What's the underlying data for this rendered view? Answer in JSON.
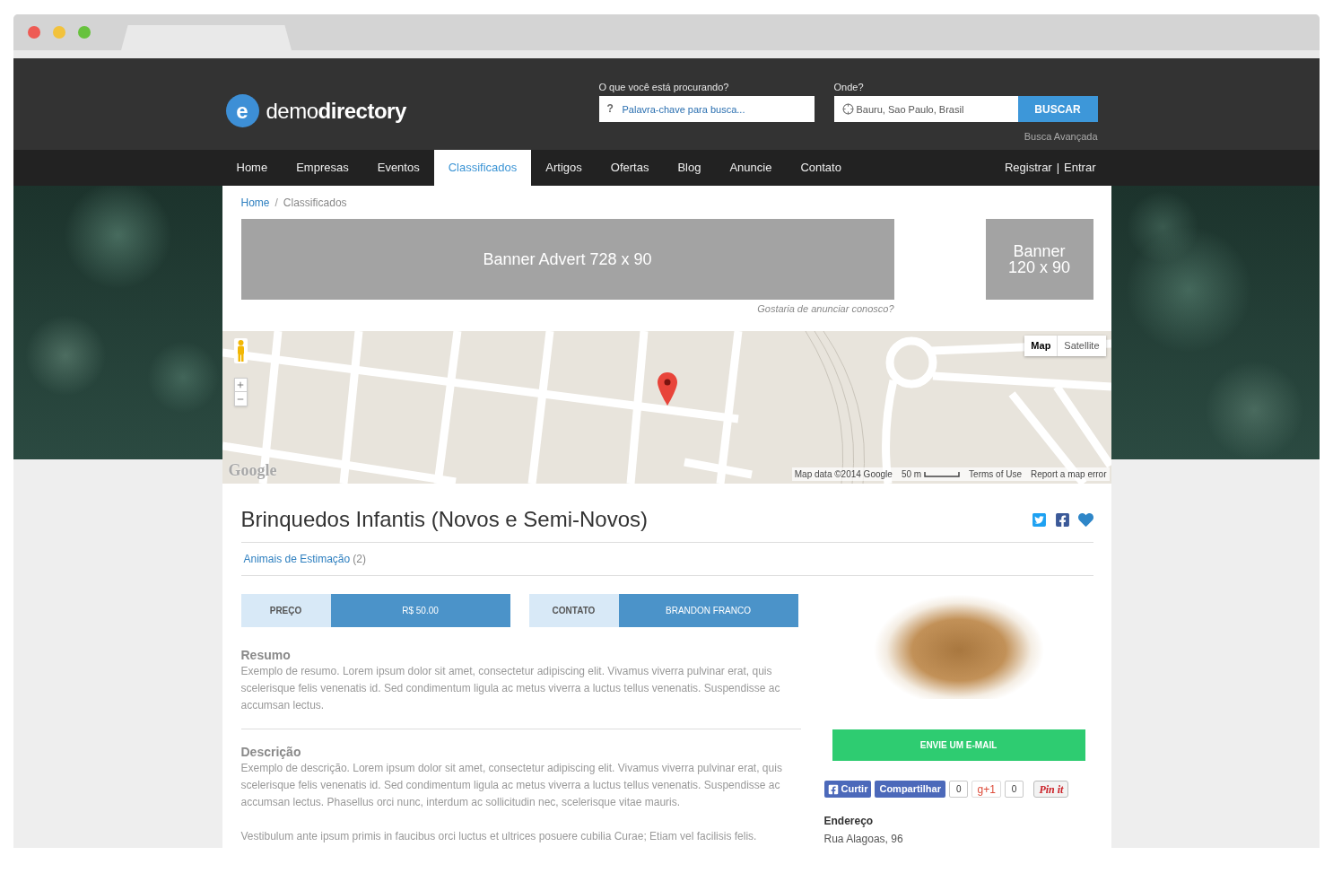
{
  "browser": {
    "buttons": [
      {
        "color": "#ee5b54"
      },
      {
        "color": "#f2c23c"
      },
      {
        "color": "#67c23d"
      }
    ]
  },
  "header": {
    "logo": {
      "mark": "e",
      "text": "demo**directory**"
    },
    "search": {
      "label": "O que você está procurando?",
      "icon": "?",
      "placeholder": "Palavra-chave para busca..."
    },
    "location": {
      "label": "Onde?",
      "value": "Bauru, Sao Paulo, Brasil"
    },
    "button": "BUSCAR",
    "advanced": "Busca Avançada"
  },
  "nav": {
    "items": [
      {
        "label": "Home",
        "selected": false
      },
      {
        "label": "Empresas",
        "selected": false
      },
      {
        "label": "Eventos",
        "selected": false
      },
      {
        "label": "Classificados",
        "selected": true
      },
      {
        "label": "Artigos",
        "selected": false
      },
      {
        "label": "Ofertas",
        "selected": false
      },
      {
        "label": "Blog",
        "selected": false
      },
      {
        "label": "Anuncie",
        "selected": false
      },
      {
        "label": "Contato",
        "selected": false
      }
    ],
    "account": {
      "links": [
        "Registrar",
        "Entrar"
      ],
      "separator": "|"
    }
  },
  "breadcrumb": {
    "items": [
      "Home",
      "Classificados"
    ],
    "separator": "/"
  },
  "banners": {
    "main": "Banner Advert 728 x 90",
    "side": "Banner 120 x 90",
    "advertise": "Gostaria de anunciar conosco?"
  },
  "map": {
    "types": [
      {
        "label": "Map",
        "selected": true
      },
      {
        "label": "Satellite",
        "selected": false
      }
    ],
    "logo": "Google",
    "attribution": "Map data ©2014 Google",
    "scale": "50 m",
    "links": [
      "Terms of Use",
      "Report a map error"
    ]
  },
  "listing": {
    "title": "Brinquedos Infantis (Novos e Semi-Novos)",
    "category": {
      "label": "Animais de Estimação",
      "count": "(2)"
    },
    "facts": [
      {
        "label": "PREÇO",
        "value": "R$ 50.00"
      },
      {
        "label": "CONTATO",
        "value": "BRANDON FRANCO"
      }
    ],
    "sections": [
      {
        "heading": "Resumo",
        "paragraphs": [
          "Exemplo de resumo. Lorem ipsum dolor sit amet, consectetur adipiscing elit. Vivamus viverra pulvinar erat, quis scelerisque felis venenatis id. Sed condimentum ligula ac metus viverra a luctus tellus venenatis. Suspendisse ac accumsan lectus."
        ]
      },
      {
        "heading": "Descrição",
        "paragraphs": [
          "Exemplo de descrição. Lorem ipsum dolor sit amet, consectetur adipiscing elit. Vivamus viverra pulvinar erat, quis scelerisque felis venenatis id. Sed condimentum ligula ac metus viverra a luctus tellus venenatis. Suspendisse ac accumsan lectus. Phasellus orci nunc, interdum ac sollicitudin nec, scelerisque vitae mauris.",
          "Vestibulum ante ipsum primis in faucibus orci luctus et ultrices posuere cubilia Curae; Etiam vel facilisis felis."
        ]
      }
    ],
    "email_button": "ENVIE UM E-MAIL",
    "share": [
      {
        "kind": "facebook_like",
        "label": "Curtir"
      },
      {
        "kind": "facebook_share",
        "label": "Compartilhar"
      },
      {
        "kind": "count",
        "label": "0"
      },
      {
        "kind": "gplus",
        "label": "g+1"
      },
      {
        "kind": "count",
        "label": "0"
      },
      {
        "kind": "pinterest",
        "label": "Pin it"
      }
    ],
    "address": {
      "label": "Endereço",
      "value": "Rua Alagoas, 96"
    }
  }
}
